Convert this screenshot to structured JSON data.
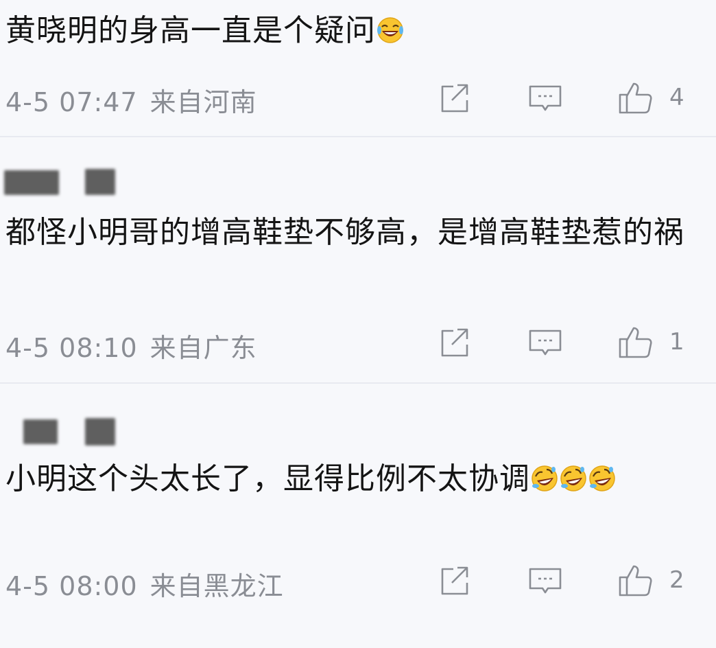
{
  "comments": [
    {
      "text": "黄晓明的身高一直是个疑问",
      "date": "4-5 07:47",
      "location": "来自河南",
      "likes": "4",
      "emojis": [
        "laugh-crying"
      ]
    },
    {
      "text": "都怪小明哥的增高鞋垫不够高，是增高鞋垫惹的祸",
      "date": "4-5 08:10",
      "location": "来自广东",
      "likes": "1",
      "emojis": []
    },
    {
      "text": "小明这个头太长了，显得比例不太协调",
      "date": "4-5 08:00",
      "location": "来自黑龙江",
      "likes": "2",
      "emojis": [
        "rolling-laughing",
        "rolling-laughing",
        "rolling-laughing"
      ]
    }
  ],
  "icons": {
    "share": "share-icon",
    "reply": "comment-icon",
    "like": "thumbs-up-icon"
  },
  "colors": {
    "background": "#f7f8fb",
    "text": "#141414",
    "meta": "#8a8d94",
    "divider": "#e8eaf0"
  }
}
